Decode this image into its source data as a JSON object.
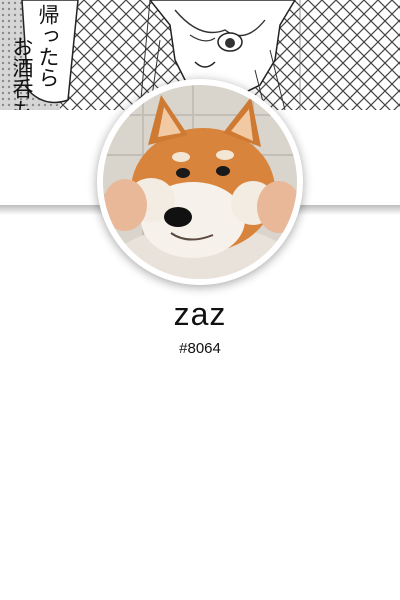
{
  "banner": {
    "speech_line_1": "帰ったら",
    "speech_line_2": "お酒呑もうか"
  },
  "profile": {
    "username": "zaz",
    "discriminator": "#8064"
  }
}
